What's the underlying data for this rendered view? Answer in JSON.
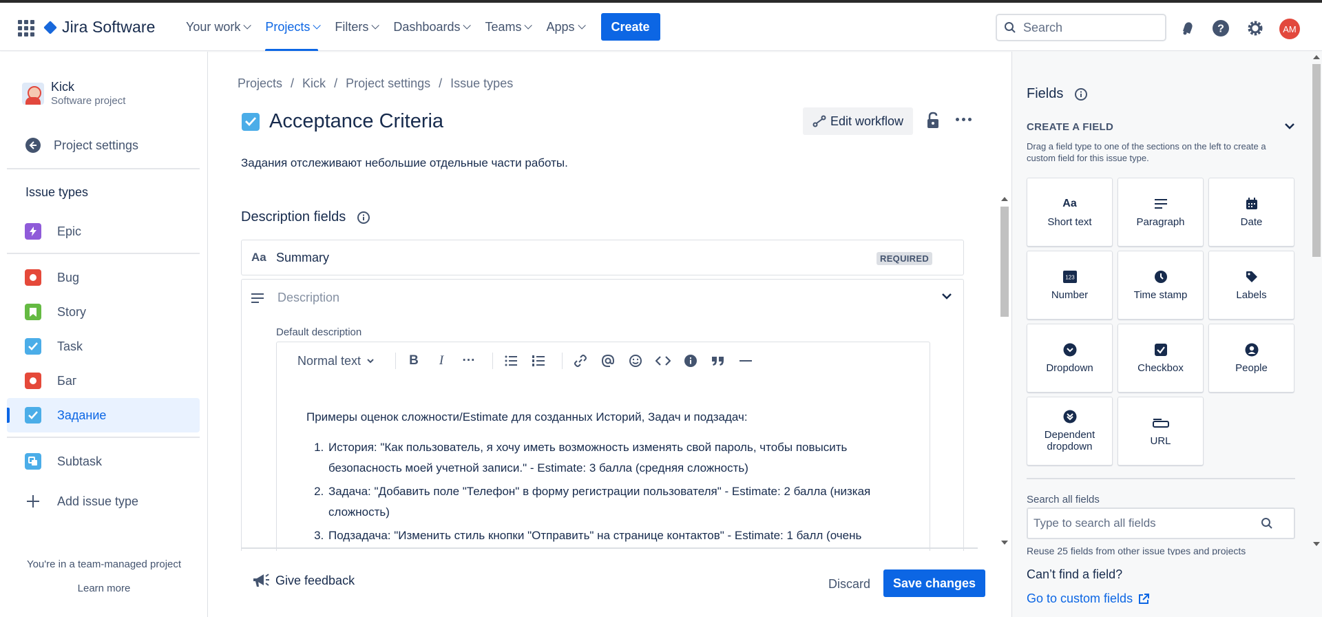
{
  "header": {
    "product": "Jira Software",
    "nav": [
      {
        "label": "Your work"
      },
      {
        "label": "Projects"
      },
      {
        "label": "Filters"
      },
      {
        "label": "Dashboards"
      },
      {
        "label": "Teams"
      },
      {
        "label": "Apps"
      }
    ],
    "create_label": "Create",
    "search_placeholder": "Search",
    "avatar_initials": "AM",
    "active_nav": "Projects"
  },
  "sidebar": {
    "project_name": "Kick",
    "project_type": "Software project",
    "back_label": "Project settings",
    "section_heading": "Issue types",
    "items": [
      {
        "label": "Epic",
        "color": "#8f5bd9"
      },
      {
        "label": "Bug",
        "color": "#e5493a"
      },
      {
        "label": "Story",
        "color": "#65ba43"
      },
      {
        "label": "Task",
        "color": "#4bade8"
      },
      {
        "label": "Баг",
        "color": "#e5493a"
      },
      {
        "label": "Задание",
        "color": "#4bade8"
      },
      {
        "label": "Subtask",
        "color": "#4bade8"
      }
    ],
    "add_label": "Add issue type",
    "team_note": "You're in a team-managed project",
    "learn_more": "Learn more"
  },
  "main": {
    "breadcrumb": [
      "Projects",
      "/",
      "Kick",
      "/",
      "Project settings",
      "/",
      "Issue types"
    ],
    "title": "Acceptance Criteria",
    "edit_workflow": "Edit workflow",
    "subtitle": "Задания отслеживают небольшие отдельные части работы.",
    "description_fields_heading": "Description fields",
    "summary_label": "Summary",
    "summary_icon_text": "Aa",
    "required_badge": "REQUIRED",
    "description_placeholder": "Description",
    "default_description_label": "Default description",
    "toolbar": {
      "text_style": "Normal text",
      "bold": "B",
      "italic": "I",
      "more": "···"
    },
    "editor": {
      "intro": "Примеры оценок сложности/Estimate для созданных Историй, Задач и подзадач:",
      "items": [
        "История: \"Как пользователь, я хочу иметь возможность изменять свой пароль, чтобы повысить безопасность моей учетной записи.\" - Estimate: 3 балла (средняя сложность)",
        "Задача: \"Добавить поле \"Телефон\" в форму регистрации пользователя\" - Estimate: 2 балла (низкая сложность)",
        "Подзадача: \"Изменить стиль кнопки \"Отправить\" на странице контактов\" - Estimate: 1 балл (очень"
      ]
    },
    "feedback_label": "Give feedback",
    "discard_label": "Discard",
    "save_label": "Save changes"
  },
  "fields_panel": {
    "title": "Fields",
    "create_heading": "CREATE A FIELD",
    "help": "Drag a field type to one of the sections on the left to create a custom field for this issue type.",
    "tiles": [
      {
        "label": "Short text",
        "icon": "short-text-icon"
      },
      {
        "label": "Paragraph",
        "icon": "paragraph-icon"
      },
      {
        "label": "Date",
        "icon": "date-icon"
      },
      {
        "label": "Number",
        "icon": "number-icon"
      },
      {
        "label": "Time stamp",
        "icon": "clock-icon"
      },
      {
        "label": "Labels",
        "icon": "label-icon"
      },
      {
        "label": "Dropdown",
        "icon": "dropdown-icon"
      },
      {
        "label": "Checkbox",
        "icon": "checkbox-icon"
      },
      {
        "label": "People",
        "icon": "people-icon"
      },
      {
        "label": "Dependent dropdown",
        "icon": "dependent-dropdown-icon"
      },
      {
        "label": "URL",
        "icon": "url-icon"
      }
    ],
    "search_label": "Search all fields",
    "search_placeholder": "Type to search all fields",
    "reuse_text": "Reuse 25 fields from other issue types and projects",
    "cant_find": "Can’t find a field?",
    "custom_fields_link": "Go to custom fields"
  },
  "colors": {
    "brand": "#0c66e4",
    "selected_bg": "#e9f2ff",
    "task_icon": "#4bade8"
  }
}
